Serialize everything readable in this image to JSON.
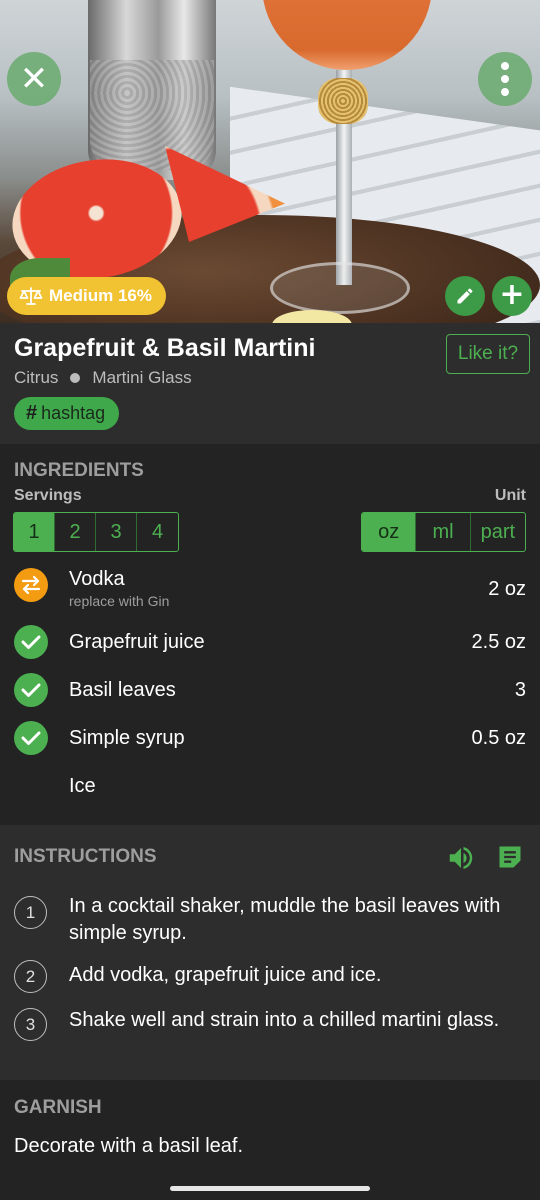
{
  "hero": {
    "strength_label": "Medium 16%"
  },
  "header": {
    "title": "Grapefruit & Basil Martini",
    "category": "Citrus",
    "glass": "Martini Glass",
    "like_label": "Like it?",
    "tag_symbol": "#",
    "tag_label": "hashtag"
  },
  "ingredients": {
    "section_title": "INGREDIENTS",
    "servings_label": "Servings",
    "unit_label": "Unit",
    "servings_options": [
      "1",
      "2",
      "3",
      "4"
    ],
    "servings_selected": "1",
    "unit_options": [
      "oz",
      "ml",
      "part"
    ],
    "unit_selected": "oz",
    "items": [
      {
        "name": "Vodka",
        "note": "replace with Gin",
        "amount": "2 oz",
        "icon": "swap-icon"
      },
      {
        "name": "Grapefruit juice",
        "note": "",
        "amount": "2.5 oz",
        "icon": "check-icon"
      },
      {
        "name": "Basil leaves",
        "note": "",
        "amount": "3",
        "icon": "check-icon"
      },
      {
        "name": "Simple syrup",
        "note": "",
        "amount": "0.5 oz",
        "icon": "check-icon"
      },
      {
        "name": "Ice",
        "note": "",
        "amount": "",
        "icon": ""
      }
    ]
  },
  "instructions": {
    "section_title": "INSTRUCTIONS",
    "steps": [
      {
        "num": "1",
        "text": "In a cocktail shaker, muddle the basil leaves with simple syrup."
      },
      {
        "num": "2",
        "text": "Add vodka, grapefruit juice and ice."
      },
      {
        "num": "3",
        "text": "Shake well and strain into a chilled martini glass."
      }
    ]
  },
  "garnish": {
    "section_title": "GARNISH",
    "text": "Decorate with a basil leaf."
  },
  "colors": {
    "accent_green": "#4caf50",
    "strength_yellow": "#f1c232",
    "swap_orange": "#f39c12",
    "background": "#232323",
    "panel": "#2d2d2d"
  }
}
